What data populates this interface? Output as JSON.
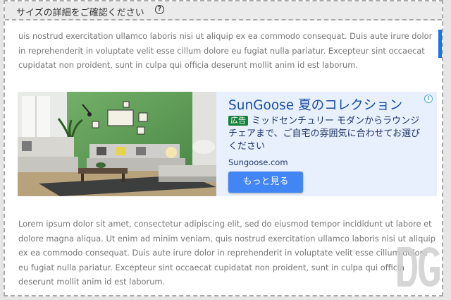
{
  "header": {
    "title": "サイズの詳細をご確認ください",
    "help_icon": "?"
  },
  "content": {
    "paragraph_top": "uis nostrud exercitation ullamco laboris nisi ut aliquip ex ea commodo consequat. Duis aute irure dolor in reprehenderit in voluptate velit esse cillum dolore eu fugiat nulla pariatur. Excepteur sint occaecat cupidatat non proident, sunt in culpa qui officia deserunt mollit anim id est laborum.",
    "paragraph_bottom": "Lorem ipsum dolor sit amet, consectetur adipiscing elit, sed do eiusmod tempor incididunt ut labore et dolore magna aliqua. Ut enim ad minim veniam, quis nostrud exercitation ullamco laboris nisi ut aliquip ex ea commodo consequat. Duis aute irure dolor in reprehenderit in voluptate velit esse cillum dolore eu fugiat nulla pariatur. Excepteur sint occaecat cupidatat non proident, sunt in culpa qui officia deserunt mollit anim id est laborum."
  },
  "ad": {
    "title": "SunGoose 夏のコレクション",
    "badge": "広告",
    "description": "ミッドセンチュリー モダンからラウンジチェアまで、ご自宅の雰囲気に合わせてお選びください",
    "url": "Sungoose.com",
    "cta_label": "もっと見る",
    "adchoices_icon": "i",
    "image": "living-room-photo"
  },
  "watermark": {
    "logo": "DG"
  },
  "colors": {
    "accent": "#1a73e8",
    "ad_background": "#e8f0fe",
    "ad_title": "#1a4ea0",
    "cta": "#4285f4",
    "badge": "#188038"
  }
}
